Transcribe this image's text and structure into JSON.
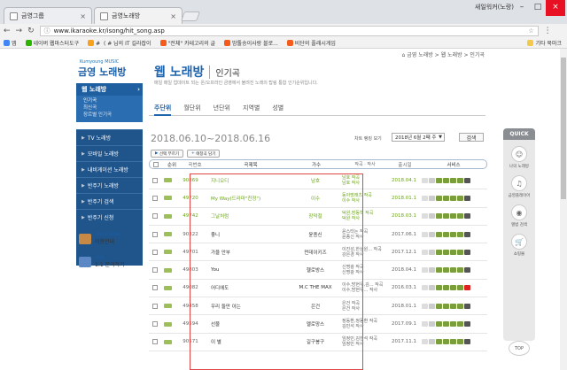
{
  "browser": {
    "tabs": [
      {
        "title": "금영그룹",
        "active": false
      },
      {
        "title": "금영노래방",
        "active": true
      }
    ],
    "user": "새일워커(노랑)",
    "url": "www.ikaraoke.kr/isong/hit_song.asp",
    "bookmarks": [
      {
        "label": "앱",
        "icon": "apps-icon",
        "color": "#4285f4"
      },
      {
        "label": "네이버 웹마스터도구",
        "icon": "naver-icon",
        "color": "#2db400"
      },
      {
        "label": "#  ( # 님의 IT 길라잡이",
        "icon": "blog-icon",
        "color": "#f7a21c"
      },
      {
        "label": "\"전체\" 카테고리의 글",
        "icon": "blog-icon",
        "color": "#f55c1c"
      },
      {
        "label": "밤톨송이사랑 블로...",
        "icon": "blog-icon",
        "color": "#f55c1c"
      },
      {
        "label": "비단의 플래시게임",
        "icon": "blog-icon",
        "color": "#f55c1c"
      },
      {
        "label": "기타 북마크",
        "icon": "folder-icon",
        "color": "#f2c94c"
      }
    ]
  },
  "sidebar": {
    "logo_small": "Kumyoung MUSIC",
    "logo": "금영 노래방",
    "active_menu": "웹 노래방",
    "submenu": [
      "인기곡",
      "최신곡",
      "장르별 인기곡"
    ],
    "menu": [
      "TV 노래방",
      "모바일 노래방",
      "내비게이션 노래방",
      "반주기 노래방",
      "반주기 검색",
      "반주기 신청"
    ],
    "guide": [
      {
        "small": "QUICK GUIDE",
        "label": "이용안내",
        "color": "#c78a46"
      },
      {
        "small": "Q&A",
        "label": "1:1 문의하기",
        "color": "#5b88c5"
      }
    ]
  },
  "main": {
    "breadcrumb": "⌂ 금영 노래방 > 웹 노래방 > 인기곡",
    "title": "웹 노래방",
    "subtitle": "인기곡",
    "description": "매일 매일 업데이트 되는 온/오프라인 금영에서 불려진 노래의 탑링 통합 인기순위입니다.",
    "tabs": [
      {
        "label": "주단위",
        "active": true
      },
      {
        "label": "월단위",
        "active": false
      },
      {
        "label": "년단위",
        "active": false
      },
      {
        "label": "지역별",
        "active": false
      },
      {
        "label": "성별",
        "active": false
      }
    ],
    "date_range": "2018.06.10~2018.06.16",
    "date_label": "차트 랭킹 보기",
    "date_select": "2018년 6월 2째 주",
    "go_button": "검색",
    "small_buttons": [
      "선택 부르기",
      "애창곡 담기"
    ],
    "columns": [
      "선택",
      "순위",
      "곡번호",
      "곡제목",
      "가수",
      "작곡 · 작사",
      "출시일",
      "서비스"
    ]
  },
  "rows": [
    {
      "num": "90869",
      "title": "지니오디",
      "singer": "남호",
      "writer": "남호 작곡\n남호 작사",
      "date": "2018.04.1",
      "highlight": true
    },
    {
      "num": "49720",
      "title": "My Way(드라마\"친정\")",
      "singer": "이수",
      "writer": "동아방래츠 작곡\n이수 작사",
      "date": "2018.01.1",
      "highlight": true
    },
    {
      "num": "49742",
      "title": "그날처럼",
      "singer": "장덕철",
      "writer": "덕원,장동혁 작곡\n덕원 작사",
      "date": "2018.03.1",
      "highlight": true
    },
    {
      "num": "90322",
      "title": "좋니",
      "singer": "윤종신",
      "writer": "윤스타는 작곡\n윤종신 작사",
      "date": "2017.06.1",
      "highlight": false
    },
    {
      "num": "49701",
      "title": "가을 안부",
      "singer": "먼데이키즈",
      "writer": "이진성,한상원... 작곡\n강은경 작사",
      "date": "2017.12.1",
      "highlight": false
    },
    {
      "num": "49803",
      "title": "You",
      "singer": "헬로방스",
      "writer": "신명광 작곡\n신명광 작사",
      "date": "2018.04.1",
      "highlight": false
    },
    {
      "num": "49082",
      "title": "어디에도",
      "singer": "M.C THE MAX",
      "writer": "이수,방현우,김... 작곡\n이수,방현우... 작사",
      "date": "2016.03.1",
      "highlight": false
    },
    {
      "num": "49458",
      "title": "우리 둘만 아는",
      "singer": "은건",
      "writer": "은건 작곡\n은건 작사",
      "date": "2018.01.1",
      "highlight": false
    },
    {
      "num": "49594",
      "title": "선물",
      "singer": "멜로망스",
      "writer": "정동환,정동환 작곡\n김민석 작사",
      "date": "2017.09.1",
      "highlight": false
    },
    {
      "num": "90571",
      "title": "이 별",
      "singer": "길구봉구",
      "writer": "임정민,김한석 작곡\n임정민 작사",
      "date": "2017.11.1",
      "highlight": false
    }
  ],
  "quick": {
    "title": "QUICK",
    "items": [
      {
        "label": "나의 노래방",
        "icon": "user-icon"
      },
      {
        "label": "금영플레이어",
        "icon": "music-icon"
      },
      {
        "label": "앨범 검색",
        "icon": "album-icon"
      },
      {
        "label": "쇼핑몰",
        "icon": "cart-icon"
      }
    ],
    "top": "TOP"
  }
}
